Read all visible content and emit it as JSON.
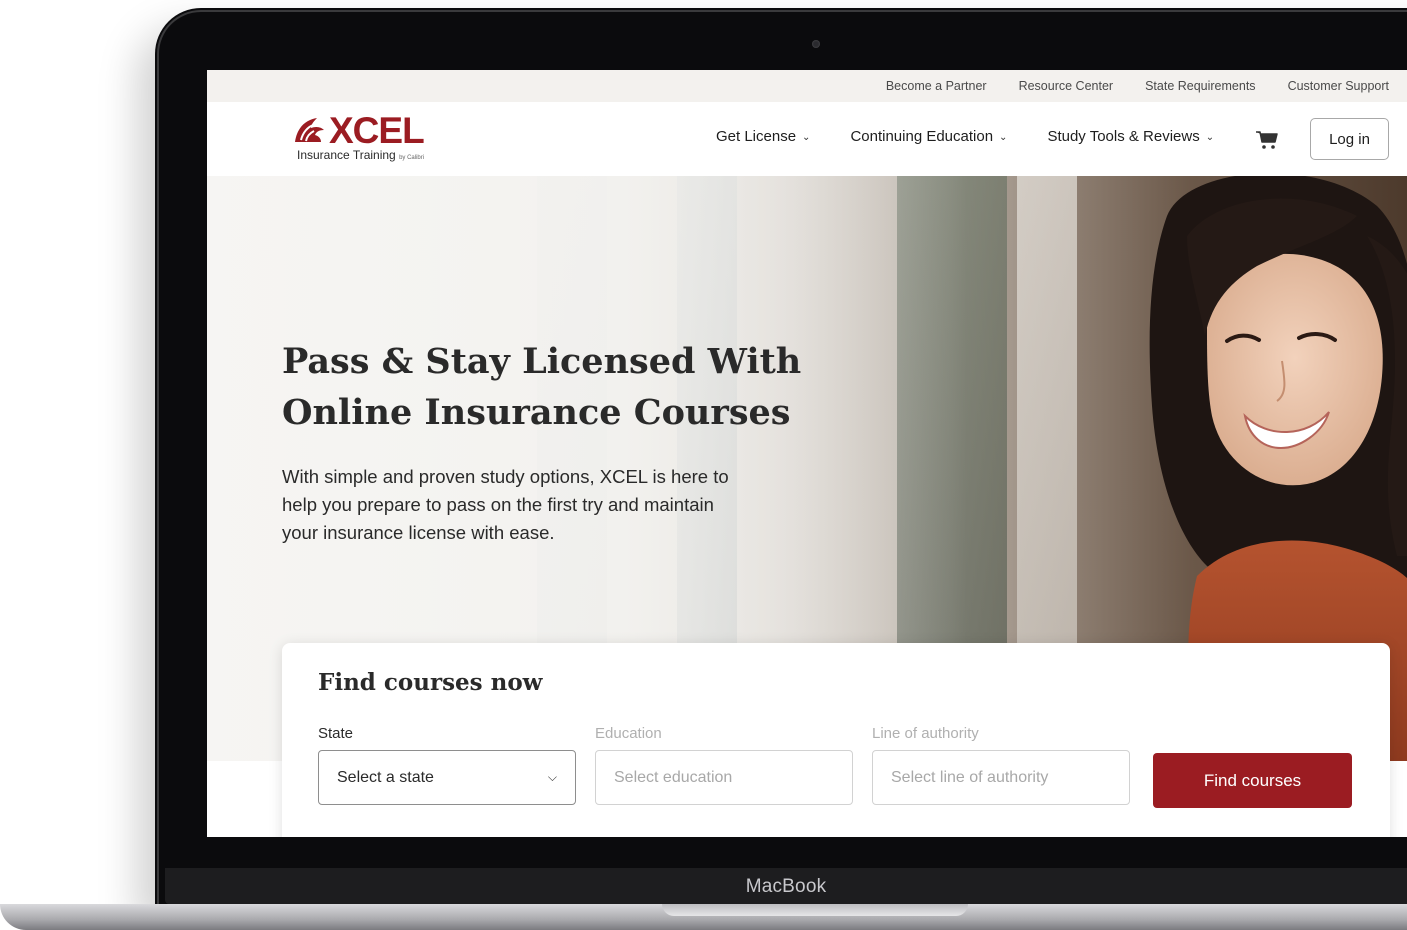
{
  "utility_nav": {
    "items": [
      "Become a Partner",
      "Resource Center",
      "State Requirements",
      "Customer Support"
    ]
  },
  "brand": {
    "name": "XCEL",
    "tagline": "Insurance Training",
    "by": "by Calibri",
    "color": "#9b1c22"
  },
  "main_nav": {
    "items": [
      {
        "label": "Get License"
      },
      {
        "label": "Continuing Education"
      },
      {
        "label": "Study Tools & Reviews"
      }
    ],
    "cart_icon": "cart-icon",
    "login_label": "Log in"
  },
  "hero": {
    "title_line1": "Pass & Stay Licensed With",
    "title_line2": "Online Insurance Courses",
    "copy": "With simple and proven study options, XCEL is here to help you prepare to pass on the first try and maintain your insurance license with ease."
  },
  "search": {
    "title": "Find courses now",
    "state_label": "State",
    "state_placeholder": "Select a state",
    "education_label": "Education",
    "education_placeholder": "Select education",
    "authority_label": "Line of authority",
    "authority_placeholder": "Select line of authority",
    "button_label": "Find courses"
  },
  "device": {
    "brand": "MacBook"
  }
}
